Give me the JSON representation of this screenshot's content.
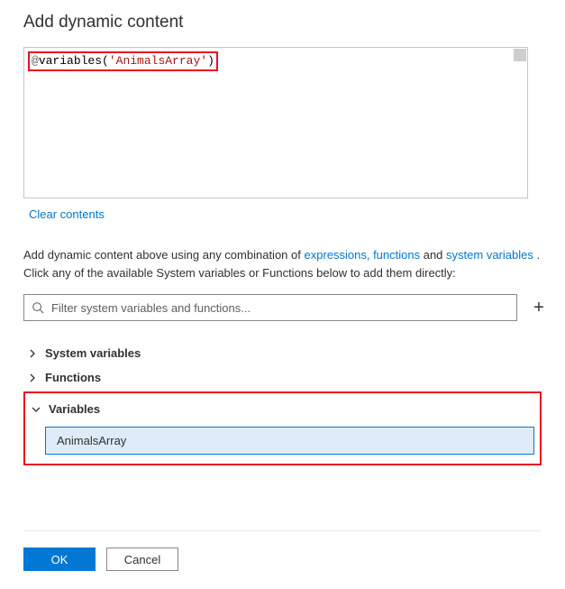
{
  "title": "Add dynamic content",
  "expression": {
    "prefix": "@",
    "fn": "variables",
    "openParen": "(",
    "argQuoted": "'AnimalsArray'",
    "closeParen": ")"
  },
  "clear_label": "Clear contents",
  "hint": {
    "t0": "Add dynamic content above using any combination of ",
    "l0": "expressions, functions",
    "t1": " and ",
    "l1": "system variables",
    "t2": " . Click any of the available System variables or Functions below to add them directly:"
  },
  "filter": {
    "placeholder": "Filter system variables and functions..."
  },
  "plus_label": "+",
  "sections": {
    "system_variables": {
      "label": "System variables",
      "expanded": false
    },
    "functions": {
      "label": "Functions",
      "expanded": false
    },
    "variables": {
      "label": "Variables",
      "expanded": true,
      "items": [
        "AnimalsArray"
      ]
    }
  },
  "buttons": {
    "ok": "OK",
    "cancel": "Cancel"
  }
}
